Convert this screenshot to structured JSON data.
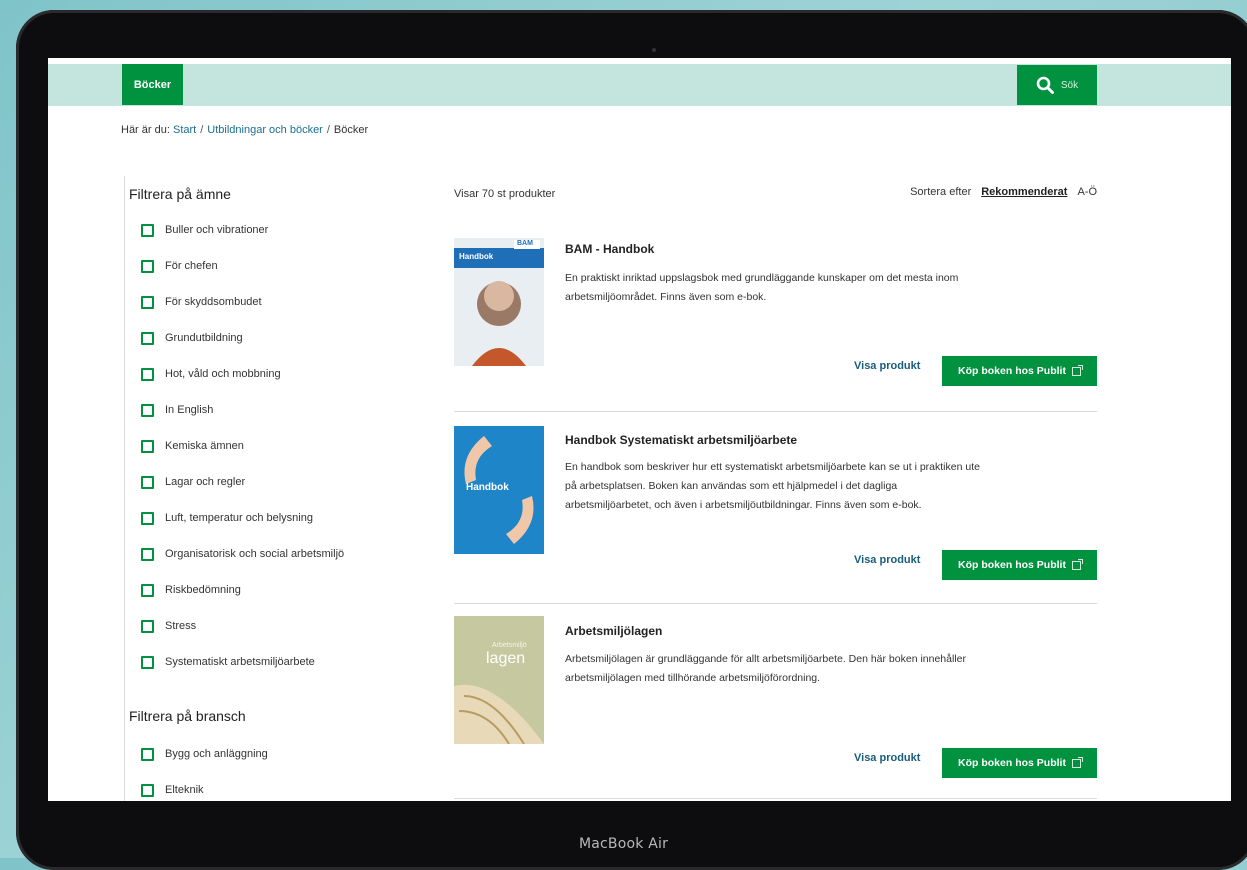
{
  "header": {
    "books_tab": "Böcker",
    "search_label": "Sök"
  },
  "breadcrumb": {
    "prefix": "Här är du:",
    "items": [
      "Start",
      "Utbildningar och böcker",
      "Böcker"
    ]
  },
  "filters": {
    "subject": {
      "title": "Filtrera på ämne",
      "items": [
        "Buller och vibrationer",
        "För chefen",
        "För skyddsombudet",
        "Grundutbildning",
        "Hot, våld och mobbning",
        "In English",
        "Kemiska ämnen",
        "Lagar och regler",
        "Luft, temperatur och belysning",
        "Organisatorisk och social arbetsmiljö",
        "Riskbedömning",
        "Stress",
        "Systematiskt arbetsmiljöarbete"
      ]
    },
    "industry": {
      "title": "Filtrera på bransch",
      "items": [
        "Bygg och anläggning",
        "Elteknik"
      ]
    }
  },
  "listing": {
    "count": "Visar 70 st produkter",
    "sort_label": "Sortera efter",
    "sort_options": [
      "Rekommenderat",
      "A-Ö"
    ],
    "view_label": "Visa produkt",
    "buy_label": "Köp boken hos Publit",
    "products": [
      {
        "title": "BAM - Handbok",
        "description": "En praktiskt inriktad uppslagsbok med grundläggande kunskaper om det mesta inom arbetsmiljöområdet. Finns även som e-bok.",
        "cover_text": "Handbok",
        "cover_logo": "BAM"
      },
      {
        "title": "Handbok Systematiskt arbetsmiljöarbete",
        "description": "En handbok som beskriver hur ett systematiskt arbetsmiljöarbete kan se ut i praktiken ute på arbetsplatsen. Boken kan användas som ett hjälpmedel i det dagliga arbetsmiljöarbetet, och även i arbetsmiljöutbildningar. Finns även som e-bok.",
        "cover_text": "Handbok"
      },
      {
        "title": "Arbetsmiljölagen",
        "description": "Arbetsmiljölagen är grundläggande för allt arbetsmiljöarbete. Den här boken innehåller arbetsmiljölagen med tillhörande arbetsmiljöförordning.",
        "cover_text_small": "Arbetsmiljö",
        "cover_text": "lagen"
      }
    ]
  },
  "device": {
    "label": "MacBook Air"
  },
  "colors": {
    "brand_green": "#00923f",
    "header_mint": "#c3e5dd",
    "link_blue": "#1a6f8f"
  }
}
